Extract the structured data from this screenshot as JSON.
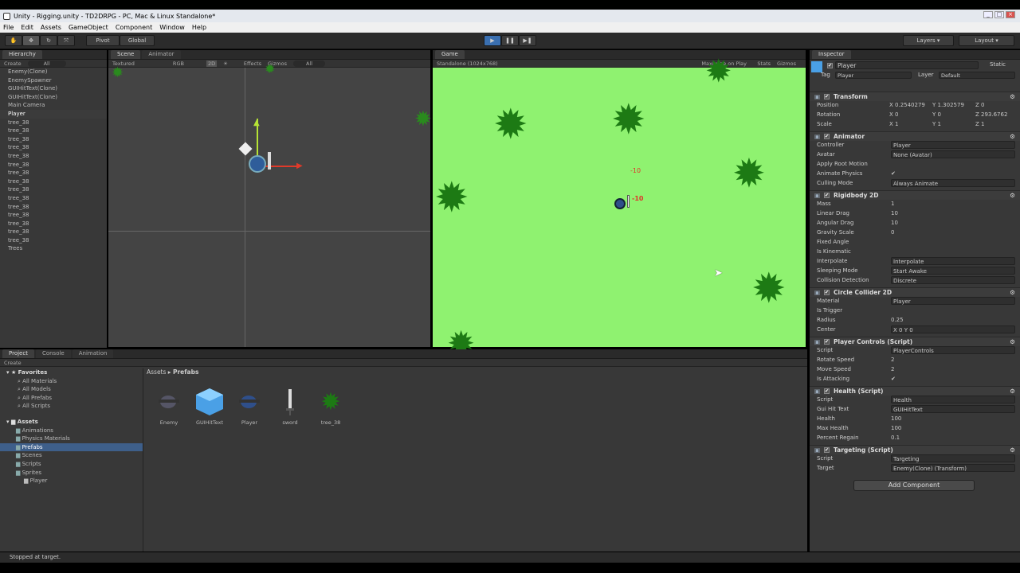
{
  "window": {
    "title": "Unity - Rigging.unity - TD2DRPG - PC, Mac & Linux Standalone*"
  },
  "menu": [
    "File",
    "Edit",
    "Assets",
    "GameObject",
    "Component",
    "Window",
    "Help"
  ],
  "toolbar": {
    "pivot": "Pivot",
    "global": "Global",
    "layers": "Layers",
    "layout": "Layout"
  },
  "hierarchy": {
    "tab": "Hierarchy",
    "create": "Create",
    "search": "All",
    "items": [
      "Enemy(Clone)",
      "EnemySpawner",
      "GUIHitText(Clone)",
      "GUIHitText(Clone)",
      "Main Camera",
      "Player",
      "tree_38",
      "tree_38",
      "tree_38",
      "tree_38",
      "tree_38",
      "tree_38",
      "tree_38",
      "tree_38",
      "tree_38",
      "tree_38",
      "tree_38",
      "tree_38",
      "tree_38",
      "tree_38",
      "tree_38",
      "Trees"
    ],
    "selected_index": 5
  },
  "scene": {
    "tab": "Scene",
    "tab2": "Animator",
    "shading": "Textured",
    "rgb": "RGB",
    "mode2d": "2D",
    "effects": "Effects",
    "gizmos": "Gizmos",
    "search": "All"
  },
  "game": {
    "tab": "Game",
    "resolution": "Standalone (1024x768)",
    "maximize": "Maximize on Play",
    "stats": "Stats",
    "gizmos": "Gizmos",
    "damage1": "-10",
    "damage2": "-10"
  },
  "project": {
    "tabs": [
      "Project",
      "Console",
      "Animation"
    ],
    "create": "Create",
    "favorites": "Favorites",
    "fav_items": [
      "All Materials",
      "All Models",
      "All Prefabs",
      "All Scripts"
    ],
    "assets": "Assets",
    "asset_folders": [
      "Animations",
      "Physics Materials",
      "Prefabs",
      "Scenes",
      "Scripts",
      "Sprites"
    ],
    "sprites_child": "Player",
    "breadcrumb_root": "Assets",
    "breadcrumb_current": "Prefabs",
    "prefabs": [
      "Enemy",
      "GUIHitText",
      "Player",
      "sword",
      "tree_38"
    ]
  },
  "inspector": {
    "tab": "Inspector",
    "name": "Player",
    "static": "Static",
    "tag_label": "Tag",
    "tag": "Player",
    "layer_label": "Layer",
    "layer": "Default",
    "transform": {
      "title": "Transform",
      "position": [
        "X 0.2540279",
        "Y 1.302579",
        "Z 0"
      ],
      "rotation": [
        "X 0",
        "Y 0",
        "Z 293.6762"
      ],
      "scale": [
        "X 1",
        "Y 1",
        "Z 1"
      ],
      "labels": [
        "Position",
        "Rotation",
        "Scale"
      ]
    },
    "animator": {
      "title": "Animator",
      "rows": [
        [
          "Controller",
          "Player"
        ],
        [
          "Avatar",
          "None (Avatar)"
        ],
        [
          "Apply Root Motion",
          ""
        ],
        [
          "Animate Physics",
          "✔"
        ],
        [
          "Culling Mode",
          "Always Animate"
        ]
      ]
    },
    "rigidbody": {
      "title": "Rigidbody 2D",
      "rows": [
        [
          "Mass",
          "1"
        ],
        [
          "Linear Drag",
          "10"
        ],
        [
          "Angular Drag",
          "10"
        ],
        [
          "Gravity Scale",
          "0"
        ],
        [
          "Fixed Angle",
          ""
        ],
        [
          "Is Kinematic",
          ""
        ],
        [
          "Interpolate",
          "Interpolate"
        ],
        [
          "Sleeping Mode",
          "Start Awake"
        ],
        [
          "Collision Detection",
          "Discrete"
        ]
      ]
    },
    "collider": {
      "title": "Circle Collider 2D",
      "rows": [
        [
          "Material",
          "Player"
        ],
        [
          "Is Trigger",
          ""
        ],
        [
          "Radius",
          "0.25"
        ],
        [
          "Center",
          "X 0     Y 0"
        ]
      ]
    },
    "controls": {
      "title": "Player Controls (Script)",
      "rows": [
        [
          "Script",
          "PlayerControls"
        ],
        [
          "Rotate Speed",
          "2"
        ],
        [
          "Move Speed",
          "2"
        ],
        [
          "Is Attacking",
          "✔"
        ]
      ]
    },
    "health": {
      "title": "Health (Script)",
      "rows": [
        [
          "Script",
          "Health"
        ],
        [
          "Gui Hit Text",
          "GUIHitText"
        ],
        [
          "Health",
          "100"
        ],
        [
          "Max Health",
          "100"
        ],
        [
          "Percent Regain",
          "0.1"
        ]
      ]
    },
    "targeting": {
      "title": "Targeting (Script)",
      "rows": [
        [
          "Script",
          "Targeting"
        ],
        [
          "Target",
          "Enemy(Clone) (Transform)"
        ]
      ]
    },
    "add_component": "Add Component"
  },
  "status": "Stopped at target."
}
